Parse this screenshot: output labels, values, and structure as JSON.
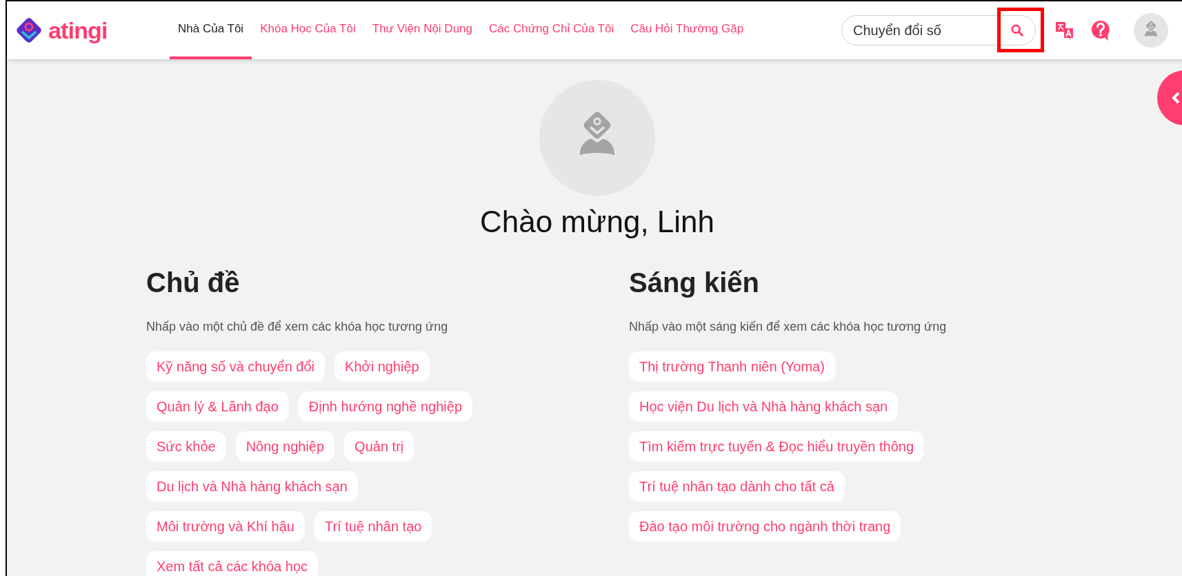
{
  "logo": {
    "text": "atingi"
  },
  "nav": [
    {
      "label": "Nhà Của Tôi",
      "selected": true
    },
    {
      "label": "Khóa Học Của Tôi",
      "selected": false
    },
    {
      "label": "Thư Viện Nội Dung",
      "selected": false
    },
    {
      "label": "Các Chứng Chỉ Của Tôi",
      "selected": false
    },
    {
      "label": "Câu Hỏi Thường Gặp",
      "selected": false
    }
  ],
  "search": {
    "value": "Chuyển đổi số"
  },
  "welcome": "Chào mừng, Linh",
  "sections": [
    {
      "title": "Chủ đề",
      "description": "Nhấp vào một chủ đề để xem các khóa học tương ứng",
      "tags": [
        "Kỹ năng số và chuyển đổi",
        "Khởi nghiệp",
        "Quản lý & Lãnh đạo",
        "Định hướng nghề nghiệp",
        "Sức khỏe",
        "Nông nghiệp",
        "Quản trị",
        "Du lịch và Nhà hàng khách sạn",
        "Môi trường và Khí hậu",
        "Trí tuệ nhân tạo",
        "Xem tất cả các khóa học"
      ]
    },
    {
      "title": "Sáng kiến",
      "description": "Nhấp vào một sáng kiến để xem các khóa học tương ứng",
      "tags": [
        "Thị trường Thanh niên (Yoma)",
        "Học viện Du lịch và Nhà hàng khách sạn",
        "Tìm kiếm trực tuyến & Đọc hiểu truyền thông",
        "Trí tuệ nhân tạo dành cho tất cả",
        "Đào tạo môi trường cho ngành thời trang"
      ]
    }
  ]
}
